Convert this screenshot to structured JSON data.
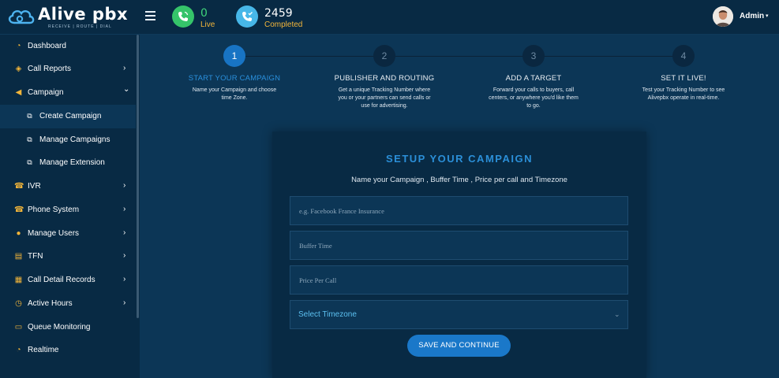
{
  "brand": {
    "name_part1": "Alive",
    "name_part2": "pbx",
    "tagline": "RECEIVE | ROUTE | DIAL"
  },
  "header": {
    "stats": {
      "live": {
        "value": "0",
        "label": "Live",
        "icon": "phone-active-icon",
        "color": "#35c46a"
      },
      "completed": {
        "value": "2459",
        "label": "Completed",
        "icon": "phone-check-icon",
        "color": "#47b7e8"
      }
    },
    "user": {
      "name": "Admin",
      "caret": "▾",
      "avatar": "avatar-icon"
    }
  },
  "sidebar": {
    "items": [
      {
        "label": "Dashboard",
        "icon": "dashboard-icon",
        "has_chevron": false
      },
      {
        "label": "Call Reports",
        "icon": "megaphone-icon",
        "has_chevron": true,
        "chevron": "›"
      },
      {
        "label": "Campaign",
        "icon": "bullhorn-icon",
        "has_chevron": true,
        "chevron": "⌄"
      },
      {
        "label": "Create Campaign",
        "icon": "copy-icon",
        "sub": true,
        "active": true
      },
      {
        "label": "Manage Campaigns",
        "icon": "copy-icon",
        "sub": true
      },
      {
        "label": "Manage Extension",
        "icon": "copy-icon",
        "sub": true
      },
      {
        "label": "IVR",
        "icon": "ivr-phone-icon",
        "has_chevron": true,
        "chevron": "›"
      },
      {
        "label": "Phone System",
        "icon": "phone-system-icon",
        "has_chevron": true,
        "chevron": "›"
      },
      {
        "label": "Manage Users",
        "icon": "user-icon",
        "has_chevron": true,
        "chevron": "›"
      },
      {
        "label": "TFN",
        "icon": "tfn-icon",
        "has_chevron": true,
        "chevron": "›"
      },
      {
        "label": "Call Detail Records",
        "icon": "clipboard-icon",
        "has_chevron": true,
        "chevron": "›"
      },
      {
        "label": "Active Hours",
        "icon": "clock-icon",
        "has_chevron": true,
        "chevron": "›"
      },
      {
        "label": "Queue Monitoring",
        "icon": "monitor-icon",
        "has_chevron": false
      },
      {
        "label": "Realtime",
        "icon": "realtime-icon",
        "has_chevron": false
      }
    ]
  },
  "wizard": {
    "steps": [
      {
        "number": "1",
        "title": "START YOUR CAMPAIGN",
        "desc": "Name your Campaign and choose time Zone.",
        "current": true
      },
      {
        "number": "2",
        "title": "PUBLISHER AND ROUTING",
        "desc": "Get a unique Tracking Number where you or your partners can send calls or use for advertising."
      },
      {
        "number": "3",
        "title": "ADD A TARGET",
        "desc": "Forward your calls to buyers, call centers, or anywhere you'd like them to go."
      },
      {
        "number": "4",
        "title": "SET IT LIVE!",
        "desc": "Test your Tracking Number to see Alivepbx operate in real-time."
      }
    ]
  },
  "form": {
    "title": "SETUP YOUR CAMPAIGN",
    "subtitle": "Name your Campaign , Buffer Time , Price per call and Timezone",
    "campaign_name": {
      "value": "",
      "placeholder": "e.g. Facebook France Insurance"
    },
    "buffer_time": {
      "value": "",
      "placeholder": "Buffer Time"
    },
    "price_per_call": {
      "value": "",
      "placeholder": "Price Per Call"
    },
    "timezone": {
      "selected": "Select Timezone",
      "chevron": "⌄"
    },
    "submit_label": "SAVE AND CONTINUE"
  },
  "colors": {
    "background": "#0c3656",
    "panel": "#082a44",
    "accent": "#1a78c9",
    "highlight": "#2b8fd8",
    "icon_gold": "#f2b53a"
  }
}
